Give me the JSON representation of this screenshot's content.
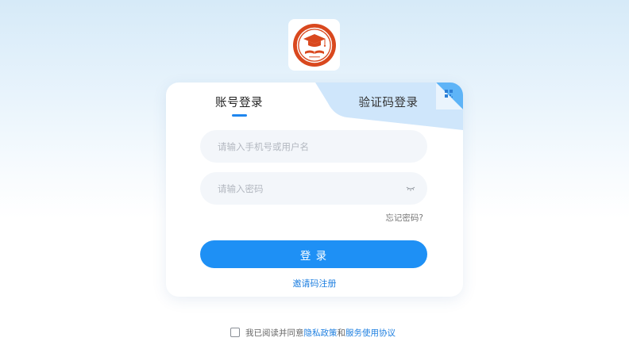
{
  "colors": {
    "primary": "#1e90f5",
    "link": "#1e7fe0",
    "logo_red": "#d9481e",
    "tab_alt_bg": "#cfe6fb"
  },
  "logo": {
    "icon": "graduation-cap-emblem-icon"
  },
  "login": {
    "tabs": [
      {
        "label": "账号登录",
        "active": true
      },
      {
        "label": "验证码登录",
        "active": false
      }
    ],
    "qr_corner_icon": "qr-code-icon",
    "username": {
      "placeholder": "请输入手机号或用户名",
      "value": ""
    },
    "password": {
      "placeholder": "请输入密码",
      "value": "",
      "toggle_icon": "eye-closed-icon"
    },
    "forgot_label": "忘记密码?",
    "submit_label": "登 录",
    "invite_label": "邀请码注册"
  },
  "agreement": {
    "checked": false,
    "prefix": "我已阅读并同意",
    "privacy": "隐私政策",
    "and": "和",
    "terms": "服务使用协议"
  }
}
